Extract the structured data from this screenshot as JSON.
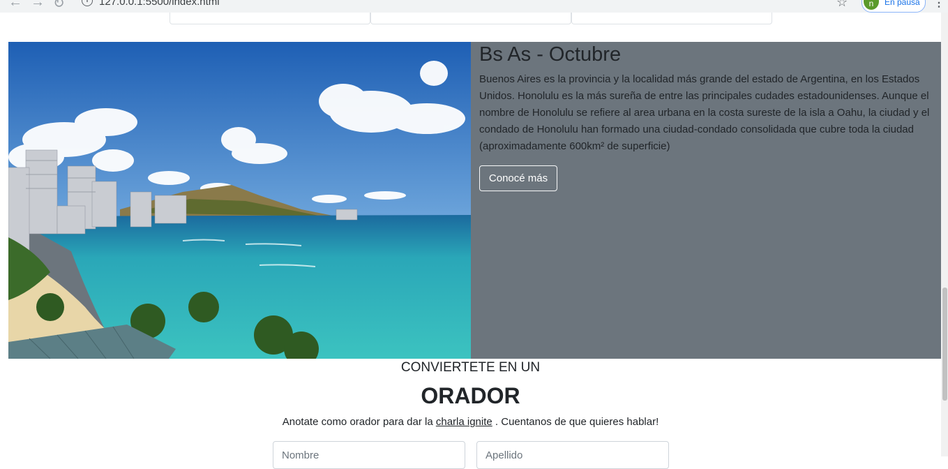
{
  "browser": {
    "url": "127.0.0.1:5500/index.html",
    "profile_label": "En pausa",
    "profile_initial": "n"
  },
  "hero": {
    "title": "Bs As - Octubre",
    "description": "Buenos Aires es la provincia y la localidad más grande del estado de Argentina, en los Estados Unidos. Honolulu es la más sureña de entre las principales cudades estadounidenses. Aunque el nombre de Honolulu se refiere al area urbana en la costa sureste de la isla a Oahu, la ciudad y el condado de Honolulu han formado una ciudad-condado consolidada que cubre toda la ciudad (aproximadamente 600km² de superficie)",
    "button_label": "Conocé más",
    "background_color": "#6c757d"
  },
  "orador": {
    "pretitle": "CONVIERTETE EN UN",
    "title": "ORADOR",
    "text_before": "Anotate como orador para dar la",
    "link_text": "charla ignite",
    "text_after": ". Cuentanos de que quieres hablar!",
    "nombre_placeholder": "Nombre",
    "apellido_placeholder": "Apellido"
  }
}
